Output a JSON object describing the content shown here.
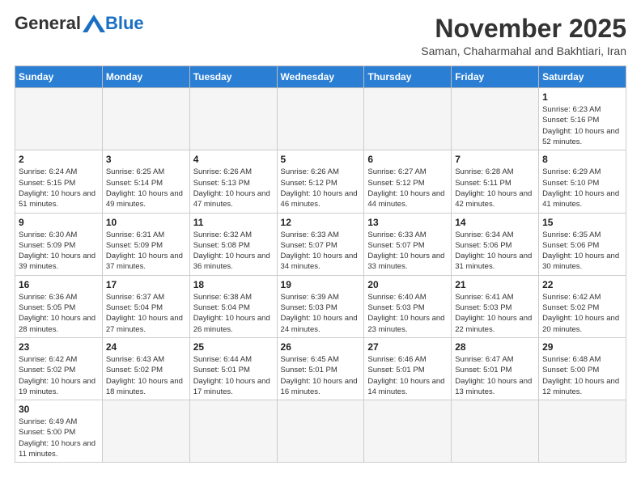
{
  "header": {
    "logo_general": "General",
    "logo_blue": "Blue",
    "month_title": "November 2025",
    "location": "Saman, Chaharmahal and Bakhtiari, Iran"
  },
  "weekdays": [
    "Sunday",
    "Monday",
    "Tuesday",
    "Wednesday",
    "Thursday",
    "Friday",
    "Saturday"
  ],
  "weeks": [
    [
      {
        "day": "",
        "empty": true
      },
      {
        "day": "",
        "empty": true
      },
      {
        "day": "",
        "empty": true
      },
      {
        "day": "",
        "empty": true
      },
      {
        "day": "",
        "empty": true
      },
      {
        "day": "",
        "empty": true
      },
      {
        "day": "1",
        "sunrise": "6:23 AM",
        "sunset": "5:16 PM",
        "daylight": "10 hours and 52 minutes."
      }
    ],
    [
      {
        "day": "2",
        "sunrise": "6:24 AM",
        "sunset": "5:15 PM",
        "daylight": "10 hours and 51 minutes."
      },
      {
        "day": "3",
        "sunrise": "6:25 AM",
        "sunset": "5:14 PM",
        "daylight": "10 hours and 49 minutes."
      },
      {
        "day": "4",
        "sunrise": "6:26 AM",
        "sunset": "5:13 PM",
        "daylight": "10 hours and 47 minutes."
      },
      {
        "day": "5",
        "sunrise": "6:26 AM",
        "sunset": "5:12 PM",
        "daylight": "10 hours and 46 minutes."
      },
      {
        "day": "6",
        "sunrise": "6:27 AM",
        "sunset": "5:12 PM",
        "daylight": "10 hours and 44 minutes."
      },
      {
        "day": "7",
        "sunrise": "6:28 AM",
        "sunset": "5:11 PM",
        "daylight": "10 hours and 42 minutes."
      },
      {
        "day": "8",
        "sunrise": "6:29 AM",
        "sunset": "5:10 PM",
        "daylight": "10 hours and 41 minutes."
      }
    ],
    [
      {
        "day": "9",
        "sunrise": "6:30 AM",
        "sunset": "5:09 PM",
        "daylight": "10 hours and 39 minutes."
      },
      {
        "day": "10",
        "sunrise": "6:31 AM",
        "sunset": "5:09 PM",
        "daylight": "10 hours and 37 minutes."
      },
      {
        "day": "11",
        "sunrise": "6:32 AM",
        "sunset": "5:08 PM",
        "daylight": "10 hours and 36 minutes."
      },
      {
        "day": "12",
        "sunrise": "6:33 AM",
        "sunset": "5:07 PM",
        "daylight": "10 hours and 34 minutes."
      },
      {
        "day": "13",
        "sunrise": "6:33 AM",
        "sunset": "5:07 PM",
        "daylight": "10 hours and 33 minutes."
      },
      {
        "day": "14",
        "sunrise": "6:34 AM",
        "sunset": "5:06 PM",
        "daylight": "10 hours and 31 minutes."
      },
      {
        "day": "15",
        "sunrise": "6:35 AM",
        "sunset": "5:06 PM",
        "daylight": "10 hours and 30 minutes."
      }
    ],
    [
      {
        "day": "16",
        "sunrise": "6:36 AM",
        "sunset": "5:05 PM",
        "daylight": "10 hours and 28 minutes."
      },
      {
        "day": "17",
        "sunrise": "6:37 AM",
        "sunset": "5:04 PM",
        "daylight": "10 hours and 27 minutes."
      },
      {
        "day": "18",
        "sunrise": "6:38 AM",
        "sunset": "5:04 PM",
        "daylight": "10 hours and 26 minutes."
      },
      {
        "day": "19",
        "sunrise": "6:39 AM",
        "sunset": "5:03 PM",
        "daylight": "10 hours and 24 minutes."
      },
      {
        "day": "20",
        "sunrise": "6:40 AM",
        "sunset": "5:03 PM",
        "daylight": "10 hours and 23 minutes."
      },
      {
        "day": "21",
        "sunrise": "6:41 AM",
        "sunset": "5:03 PM",
        "daylight": "10 hours and 22 minutes."
      },
      {
        "day": "22",
        "sunrise": "6:42 AM",
        "sunset": "5:02 PM",
        "daylight": "10 hours and 20 minutes."
      }
    ],
    [
      {
        "day": "23",
        "sunrise": "6:42 AM",
        "sunset": "5:02 PM",
        "daylight": "10 hours and 19 minutes."
      },
      {
        "day": "24",
        "sunrise": "6:43 AM",
        "sunset": "5:02 PM",
        "daylight": "10 hours and 18 minutes."
      },
      {
        "day": "25",
        "sunrise": "6:44 AM",
        "sunset": "5:01 PM",
        "daylight": "10 hours and 17 minutes."
      },
      {
        "day": "26",
        "sunrise": "6:45 AM",
        "sunset": "5:01 PM",
        "daylight": "10 hours and 16 minutes."
      },
      {
        "day": "27",
        "sunrise": "6:46 AM",
        "sunset": "5:01 PM",
        "daylight": "10 hours and 14 minutes."
      },
      {
        "day": "28",
        "sunrise": "6:47 AM",
        "sunset": "5:01 PM",
        "daylight": "10 hours and 13 minutes."
      },
      {
        "day": "29",
        "sunrise": "6:48 AM",
        "sunset": "5:00 PM",
        "daylight": "10 hours and 12 minutes."
      }
    ],
    [
      {
        "day": "30",
        "sunrise": "6:49 AM",
        "sunset": "5:00 PM",
        "daylight": "10 hours and 11 minutes."
      },
      {
        "day": "",
        "empty": true
      },
      {
        "day": "",
        "empty": true
      },
      {
        "day": "",
        "empty": true
      },
      {
        "day": "",
        "empty": true
      },
      {
        "day": "",
        "empty": true
      },
      {
        "day": "",
        "empty": true
      }
    ]
  ]
}
